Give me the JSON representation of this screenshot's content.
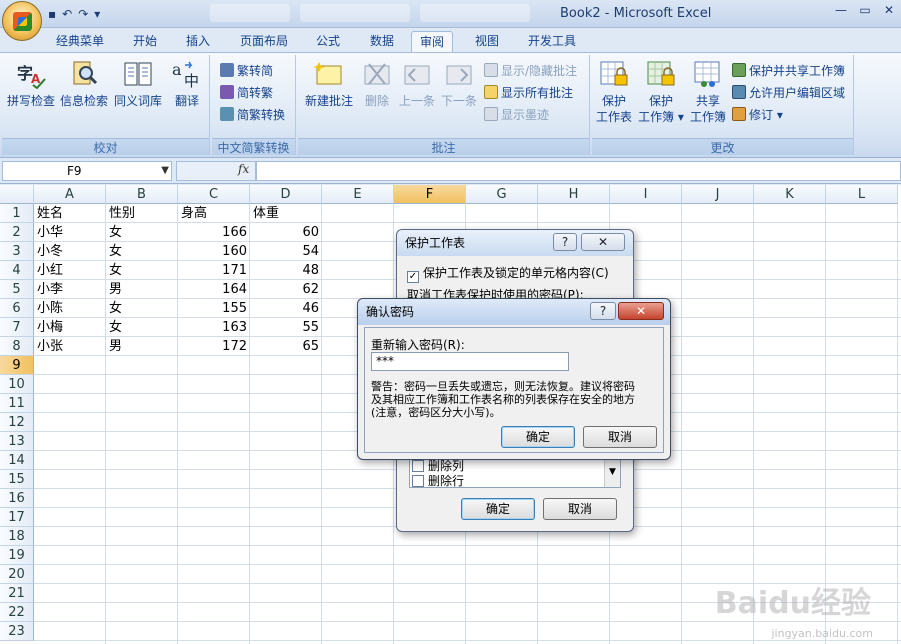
{
  "window": {
    "title": "Book2 - Microsoft Excel",
    "minimize": "—",
    "restore": "▭",
    "close": "✕"
  },
  "qat": {
    "save": "▪",
    "undo": "↶",
    "redo": "↷",
    "customize": "▾"
  },
  "tabs": [
    {
      "label": "经典菜单"
    },
    {
      "label": "开始"
    },
    {
      "label": "插入"
    },
    {
      "label": "页面布局"
    },
    {
      "label": "公式"
    },
    {
      "label": "数据"
    },
    {
      "label": "审阅"
    },
    {
      "label": "视图"
    },
    {
      "label": "开发工具"
    }
  ],
  "ribbon": {
    "proofing": {
      "label": "校对",
      "spelling": "拼写检查",
      "research": "信息检索",
      "thesaurus": "同义词库",
      "translate": "翻译"
    },
    "chinese": {
      "label": "中文简繁转换",
      "to_simplified": "繁转简",
      "to_traditional": "简转繁",
      "convert": "简繁转换"
    },
    "comments": {
      "label": "批注",
      "new": "新建批注",
      "delete": "删除",
      "previous": "上一条",
      "next": "下一条",
      "show_hide": "显示/隐藏批注",
      "show_all": "显示所有批注",
      "show_ink": "显示墨迹"
    },
    "changes": {
      "label": "更改",
      "protect_sheet_1": "保护",
      "protect_sheet_2": "工作表",
      "protect_book_1": "保护",
      "protect_book_2": "工作簿",
      "share_book_1": "共享",
      "share_book_2": "工作簿",
      "protect_share": "保护并共享工作簿",
      "allow_edit": "允许用户编辑区域",
      "track": "修订"
    }
  },
  "formula_bar": {
    "name_box": "F9",
    "fx": "fx",
    "value": ""
  },
  "grid": {
    "columns": [
      "A",
      "B",
      "C",
      "D",
      "E",
      "F",
      "G",
      "H",
      "I",
      "J",
      "K",
      "L"
    ],
    "rows": [
      "1",
      "2",
      "3",
      "4",
      "5",
      "6",
      "7",
      "8",
      "9",
      "10",
      "11",
      "12",
      "13",
      "14",
      "15",
      "16",
      "17",
      "18",
      "19",
      "20",
      "21",
      "22",
      "23"
    ],
    "selected_cell": "F9",
    "header": [
      "姓名",
      "性别",
      "身高",
      "体重"
    ],
    "data": [
      [
        "小华",
        "女",
        166,
        60
      ],
      [
        "小冬",
        "女",
        160,
        54
      ],
      [
        "小红",
        "女",
        171,
        48
      ],
      [
        "小李",
        "男",
        164,
        62
      ],
      [
        "小陈",
        "女",
        155,
        46
      ],
      [
        "小梅",
        "女",
        163,
        55
      ],
      [
        "小张",
        "男",
        172,
        65
      ]
    ]
  },
  "protect_dialog": {
    "title": "保护工作表",
    "help": "?",
    "close": "✕",
    "check_protect": "保护工作表及锁定的单元格内容(C)",
    "password_label": "取消工作表保护时使用的密码(P):",
    "perm_delete_cols": "删除列",
    "perm_delete_rows": "删除行",
    "ok": "确定",
    "cancel": "取消"
  },
  "confirm_dialog": {
    "title": "确认密码",
    "help": "?",
    "close": "✕",
    "reenter_label": "重新输入密码(R):",
    "password_value": "***",
    "warning_line1": "警告：密码一旦丢失或遗忘，则无法恢复。建议将密码",
    "warning_line2": "及其相应工作簿和工作表名称的列表保存在安全的地方",
    "warning_line3": "(注意，密码区分大小写)。",
    "ok": "确定",
    "cancel": "取消"
  },
  "watermark": {
    "brand": "Baidu经验",
    "url": "jingyan.baidu.com"
  },
  "colors": {
    "ribbon_text": "#15428b",
    "selected_header": "#f1c15f",
    "close_button": "#c4422d"
  }
}
